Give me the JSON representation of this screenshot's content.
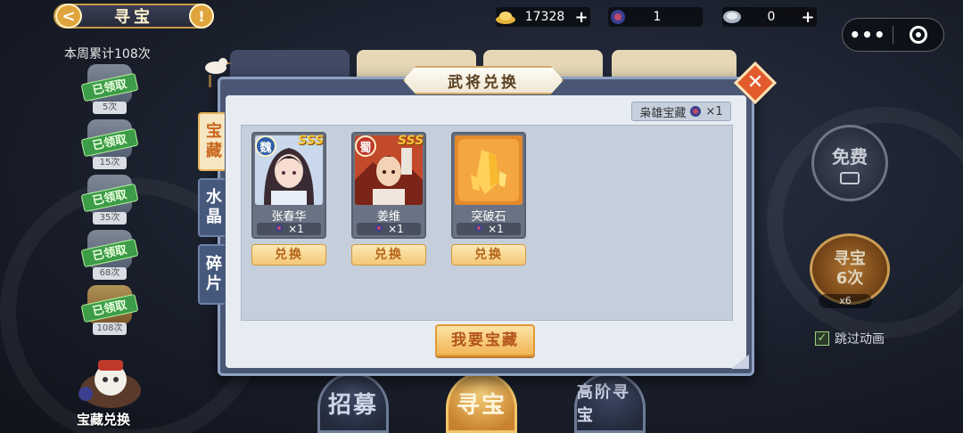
{
  "top": {
    "back_glyph": "<",
    "title": "寻宝",
    "warn_glyph": "!",
    "resources": [
      {
        "icon": "gold-ingot-icon",
        "value": "17328"
      },
      {
        "icon": "treasure-token-icon",
        "value": "1"
      },
      {
        "icon": "silver-token-icon",
        "value": "0"
      }
    ],
    "plus": "+",
    "mini_more": "•••"
  },
  "left": {
    "week_count": "本周累计108次",
    "chests": [
      {
        "tag": "已领取",
        "count": "5次"
      },
      {
        "tag": "已领取",
        "count": "15次"
      },
      {
        "tag": "已领取",
        "count": "35次"
      },
      {
        "tag": "已领取",
        "count": "68次"
      },
      {
        "tag": "已领取",
        "count": "108次"
      }
    ],
    "redeem_label": "宝藏兑换"
  },
  "right": {
    "free_label": "免费",
    "hunt_label_1": "寻宝",
    "hunt_label_2": "6次",
    "hunt_mult": "x6",
    "skip_label": "跳过动画",
    "skip_check": "✓"
  },
  "bottom": {
    "btn1": "招募",
    "btn2": "寻宝",
    "btn3": "高阶寻宝"
  },
  "dialog": {
    "title": "武将兑换",
    "close": "✕",
    "tabs": [
      {
        "label": "宝藏",
        "active": true
      },
      {
        "label": "水晶",
        "active": false
      },
      {
        "label": "碎片",
        "active": false
      }
    ],
    "owned_label": "枭雄宝藏",
    "owned_qty": "×1",
    "items": [
      {
        "name": "张春华",
        "faction": "魏",
        "faction_color": "#2f5fa8",
        "grade": "SSS",
        "qty": "×1",
        "button": "兑换"
      },
      {
        "name": "姜维",
        "faction": "蜀",
        "faction_color": "#c0392b",
        "grade": "SSS",
        "qty": "×1",
        "button": "兑换"
      },
      {
        "name": "突破石",
        "faction": "",
        "faction_color": "",
        "grade": "",
        "qty": "×1",
        "button": "兑换"
      }
    ],
    "want_button": "我要宝藏"
  },
  "colors": {
    "accent_gold": "#f2b656",
    "tab_active": "#f6e6c2",
    "tab_inactive": "#46597d",
    "dialog_frame": "#4a5774",
    "claimed_green": "#3c9c48"
  }
}
